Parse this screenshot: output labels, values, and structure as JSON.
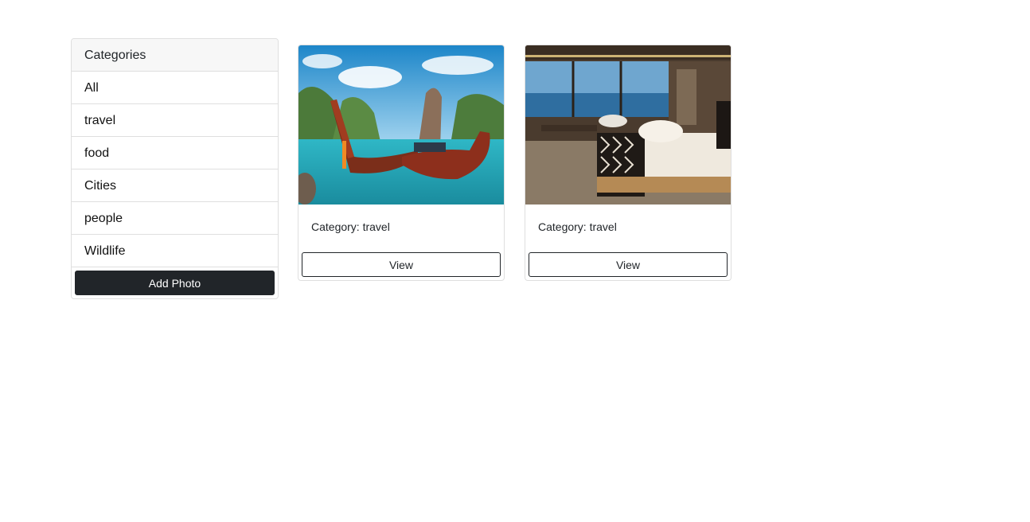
{
  "sidebar": {
    "title": "Categories",
    "items": [
      {
        "label": "All"
      },
      {
        "label": "travel"
      },
      {
        "label": "food"
      },
      {
        "label": "Cities"
      },
      {
        "label": "people"
      },
      {
        "label": "Wildlife"
      }
    ],
    "add_label": "Add Photo"
  },
  "cards": [
    {
      "category_text": "Category: travel",
      "view_label": "View",
      "image_subject": "longtail boats on turquoise bay with limestone karsts"
    },
    {
      "category_text": "Category: travel",
      "view_label": "View",
      "image_subject": "luxury hotel bedroom with ocean view"
    }
  ],
  "colors": {
    "primary_dark": "#212529",
    "border": "#dfdfdf",
    "header_bg": "#f7f7f7"
  }
}
